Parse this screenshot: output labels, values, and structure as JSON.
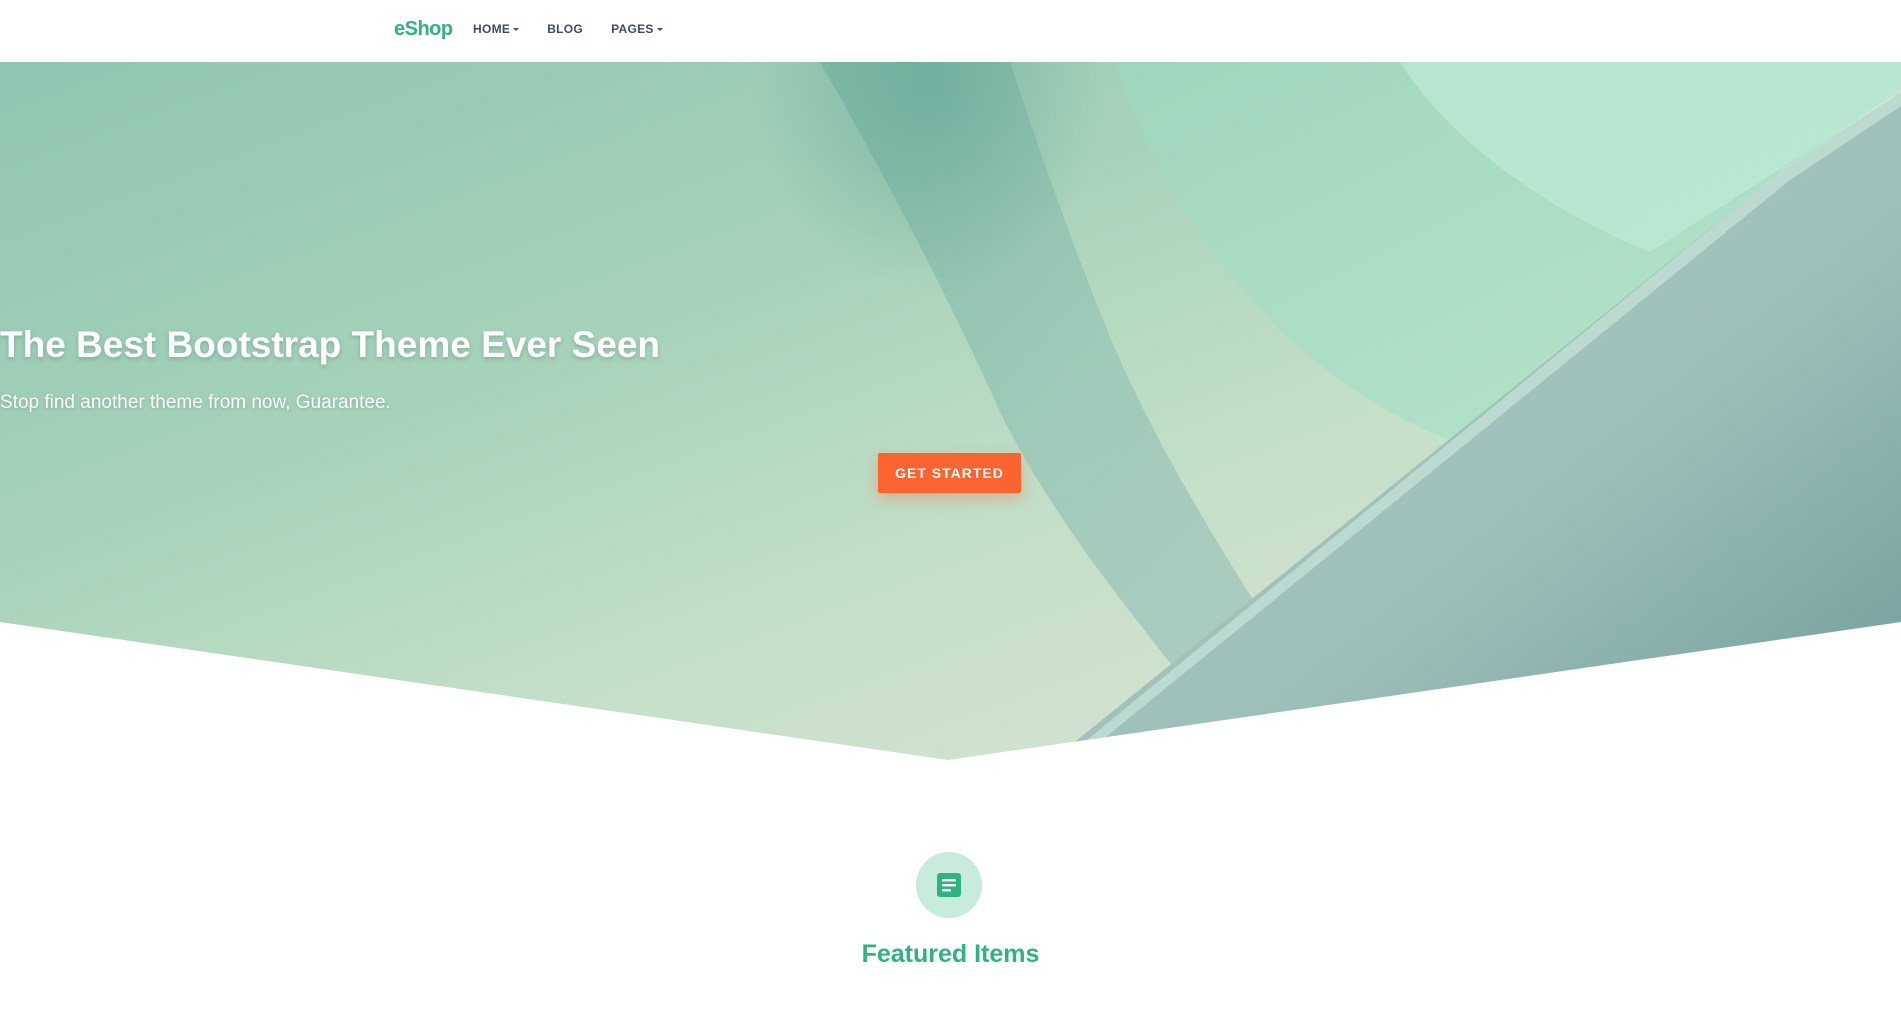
{
  "navbar": {
    "brand": "eShop",
    "items": [
      {
        "label": "HOME",
        "dropdown": true
      },
      {
        "label": "BLOG",
        "dropdown": false
      },
      {
        "label": "PAGES",
        "dropdown": true
      }
    ]
  },
  "hero": {
    "title": "The Best Bootstrap Theme Ever Seen",
    "subtitle": "Stop find another theme from now, Guarantee.",
    "cta_label": "GET STARTED"
  },
  "featured": {
    "icon": "document-icon",
    "title": "Featured Items"
  },
  "colors": {
    "brand": "#2fb380",
    "accent": "#fa6431",
    "nav_text": "#3f4a63",
    "icon_bg": "#c8ecdc"
  }
}
